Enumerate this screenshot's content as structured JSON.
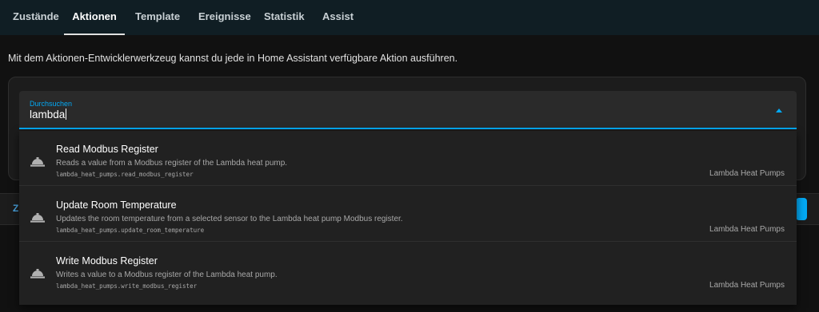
{
  "tabs": [
    {
      "label": "Zustände",
      "active": false
    },
    {
      "label": "Aktionen",
      "active": true
    },
    {
      "label": "Template",
      "active": false
    },
    {
      "label": "Ereignisse",
      "active": false
    },
    {
      "label": "Statistik",
      "active": false
    },
    {
      "label": "Assist",
      "active": false
    }
  ],
  "intro": "Mit dem Aktionen-Entwicklerwerkzeug kannst du jede in Home Assistant verfügbare Aktion ausführen.",
  "search": {
    "label": "Durchsuchen",
    "value": "lambda"
  },
  "lowerbar": {
    "partial_label": "Z"
  },
  "results": [
    {
      "title": "Read Modbus Register",
      "description": "Reads a value from a Modbus register of the Lambda heat pump.",
      "service_id": "lambda_heat_pumps.read_modbus_register",
      "integration": "Lambda Heat Pumps",
      "icon": "service-bell-icon"
    },
    {
      "title": "Update Room Temperature",
      "description": "Updates the room temperature from a selected sensor to the Lambda heat pump Modbus register.",
      "service_id": "lambda_heat_pumps.update_room_temperature",
      "integration": "Lambda Heat Pumps",
      "icon": "service-bell-icon"
    },
    {
      "title": "Write Modbus Register",
      "description": "Writes a value to a Modbus register of the Lambda heat pump.",
      "service_id": "lambda_heat_pumps.write_modbus_register",
      "integration": "Lambda Heat Pumps",
      "icon": "service-bell-icon"
    }
  ],
  "colors": {
    "accent": "#03a9f4",
    "topbar": "#101e24",
    "background": "#111111"
  }
}
